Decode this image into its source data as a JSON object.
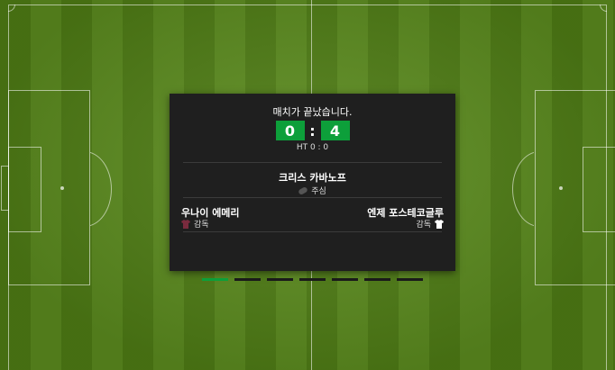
{
  "result": {
    "status": "매치가 끝났습니다.",
    "home_score": "0",
    "separator": ":",
    "away_score": "4",
    "halftime": "HT 0 : 0"
  },
  "referee": {
    "name": "크리스 카바노프",
    "role": "주심",
    "icon": "whistle-icon"
  },
  "managers": {
    "home": {
      "name": "우나이 에메리",
      "role": "감독",
      "shirt_color": "#7a2b3e",
      "icon": "shirt-icon"
    },
    "away": {
      "name": "엔제 포스테코글루",
      "role": "감독",
      "shirt_color": "#ffffff",
      "icon": "shirt-icon"
    }
  },
  "pagination": {
    "count": 7,
    "active_index": 0
  },
  "colors": {
    "accent": "#0d9f3a",
    "card_bg": "#1f1f1f",
    "pitch_dark": "#4f7d15",
    "pitch_light": "#5c8c1f"
  }
}
